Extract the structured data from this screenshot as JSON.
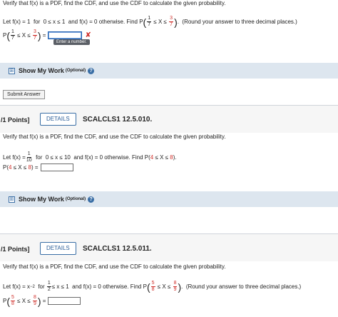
{
  "problem1": {
    "intro": "Verify that f(x) is a PDF, find the CDF, and use the CDF to calculate the given probability.",
    "let": "Let",
    "fx_eq": "f(x) = 1",
    "for": "for",
    "domain": "0 ≤ x ≤ 1",
    "and": "and",
    "fx_zero": "f(x) = 0",
    "otherwise": "otherwise. Find",
    "P": "P",
    "lower_num": "1",
    "lower_den": "7",
    "le_x_le": "≤ X ≤",
    "upper_num": "3",
    "upper_den": "7",
    "round_note": "(Round your answer to three decimal places.)",
    "eq": "=",
    "tooltip": "Enter a number.",
    "error_icon": "x-mark"
  },
  "show_my_work": {
    "label": "Show My Work",
    "optional": "(Optional)",
    "toggle": "⊞",
    "help": "?"
  },
  "submit_label": "Submit Answer",
  "problem2": {
    "points": "/1 Points]",
    "details": "DETAILS",
    "code": "SCALCLS1 12.5.010.",
    "intro": "Verify that f(x) is a PDF, find the CDF, and use the CDF to calculate the given probability.",
    "let": "Let",
    "fx_eq": "f(x) =",
    "coef_num": "1",
    "coef_den": "10",
    "for": "for",
    "domain": "0 ≤ x ≤ 10",
    "and": "and",
    "fx_zero": "f(x) = 0",
    "otherwise": "otherwise. Find",
    "P": "P(",
    "a": "4",
    "le_x_le": "≤ X ≤",
    "b": "8",
    "close": ").",
    "lhs_open": "P(",
    "lhs_close": ") ="
  },
  "problem3": {
    "points": "/1 Points]",
    "details": "DETAILS",
    "code": "SCALCLS1 12.5.011.",
    "intro": "Verify that f(x) is a PDF, find the CDF, and use the CDF to calculate the given probability.",
    "let": "Let",
    "fx_eq": "f(x) = x",
    "exp": "−2",
    "for": "for",
    "half_num": "1",
    "half_den": "2",
    "le_x_le1": "≤ x ≤ 1",
    "and": "and",
    "fx_zero": "f(x) = 0",
    "otherwise": "otherwise. Find",
    "P": "P",
    "lower_num": "5",
    "lower_den": "8",
    "le_x_le": "≤ X ≤",
    "upper_num": "8",
    "upper_den": "9",
    "round_note": "(Round your answer to three decimal places.)",
    "eq": "="
  }
}
